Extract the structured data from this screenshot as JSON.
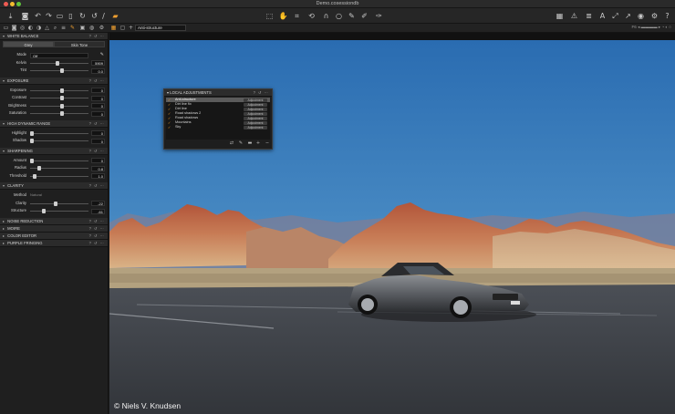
{
  "window": {
    "title": "Demo.cosessiondb"
  },
  "toolbar": {
    "left_icons": [
      "import-icon",
      "capture-icon",
      "undo-icon",
      "redo-icon",
      "folder-icon",
      "trash-icon",
      "rotate-icon",
      "reset-icon",
      "brush-icon",
      "camera-icon"
    ],
    "center_icons": [
      "select-icon",
      "pan-icon",
      "crop-icon",
      "rotate-icon",
      "keystone-icon",
      "spot-icon",
      "picker-icon",
      "brush-icon",
      "eraser-icon"
    ],
    "right_icons": [
      "grid-icon",
      "warning-icon",
      "list-icon",
      "text-icon",
      "loupe-icon",
      "arrow-icon",
      "eye-icon",
      "gear-icon",
      "help-icon"
    ]
  },
  "tabrow": {
    "active_layer": "Anti-structure",
    "right_text": "F6"
  },
  "white_balance": {
    "header": "WHITE BALANCE",
    "tabs": [
      "Grey",
      "Skin Tone"
    ],
    "active_tab": 0,
    "mode_label": "Mode",
    "mode_value": "Off",
    "kelvin_label": "Kelvin",
    "kelvin_value": "5909",
    "tint_label": "Tint",
    "tint_value": "0.0"
  },
  "exposure": {
    "header": "EXPOSURE",
    "rows": [
      {
        "label": "Exposure",
        "value": "0",
        "level": 0.5
      },
      {
        "label": "Contrast",
        "value": "0",
        "level": 0.5
      },
      {
        "label": "Brightness",
        "value": "0",
        "level": 0.5
      },
      {
        "label": "Saturation",
        "value": "0",
        "level": 0.5
      }
    ]
  },
  "hdr": {
    "header": "HIGH DYNAMIC RANGE",
    "rows": [
      {
        "label": "Highlight",
        "value": "0",
        "level": 0
      },
      {
        "label": "Shadow",
        "value": "0",
        "level": 0
      }
    ]
  },
  "sharpening": {
    "header": "SHARPENING",
    "rows": [
      {
        "label": "Amount",
        "value": "0",
        "level": 0
      },
      {
        "label": "Radius",
        "value": "0.8",
        "level": 0.12
      },
      {
        "label": "Threshold",
        "value": "1.0",
        "level": 0.05
      }
    ]
  },
  "clarity": {
    "header": "CLARITY",
    "method_label": "Method",
    "method_value": "Natural",
    "rows": [
      {
        "label": "Clarity",
        "value": "-22",
        "level": 0.39
      },
      {
        "label": "Structure",
        "value": "-61",
        "level": 0.2
      }
    ]
  },
  "collapsed_tools": [
    "NOISE REDUCTION",
    "MOIRE",
    "COLOR EDITOR",
    "PURPLE FRINGING"
  ],
  "local_adjustments": {
    "header": "LOCAL ADJUSTMENTS",
    "items": [
      {
        "name": "Anti-structure",
        "type": "Adjustment",
        "checked": true,
        "selected": true
      },
      {
        "name": "Dirt line fix",
        "type": "Adjustment",
        "checked": true,
        "selected": false
      },
      {
        "name": "Dirt line",
        "type": "Adjustment",
        "checked": true,
        "selected": false
      },
      {
        "name": "Road shadows 2",
        "type": "Adjustment",
        "checked": true,
        "selected": false
      },
      {
        "name": "Road shadows",
        "type": "Adjustment",
        "checked": true,
        "selected": false
      },
      {
        "name": "Mountains",
        "type": "Adjustment",
        "checked": true,
        "selected": false
      },
      {
        "name": "Sky",
        "type": "Adjustment",
        "checked": true,
        "selected": false
      },
      {
        "name": "",
        "type": "",
        "checked": false,
        "selected": false
      }
    ]
  },
  "viewer": {
    "copyright": "© Niels V. Knudsen"
  },
  "colors": {
    "accent": "#f0a030",
    "panel_bg": "#1f1f1f",
    "header_bg": "#2b2b2b",
    "sky_top": "#2b6db2",
    "sky_bottom": "#6aa3cf"
  }
}
